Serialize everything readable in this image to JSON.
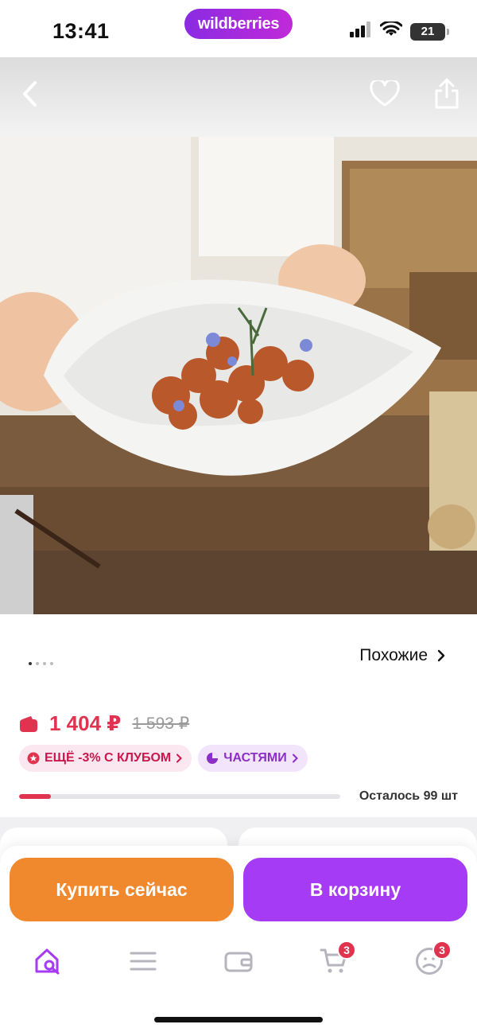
{
  "status_bar": {
    "time": "13:41",
    "app_badge": "wildberries",
    "battery": "21",
    "icons": [
      "signal-icon",
      "wifi-icon",
      "battery-icon"
    ]
  },
  "header": {
    "icons": [
      "back-icon",
      "heart-icon",
      "share-icon"
    ]
  },
  "gallery": {
    "image_description": "product-photo",
    "dots_count": 4,
    "active_dot": 0
  },
  "similar": {
    "label": "Похожие"
  },
  "price": {
    "current": "1 404 ₽",
    "old": "1 593 ₽",
    "wallet_icon": "wallet-icon"
  },
  "badges": {
    "club": "ЕЩЁ -3% С КЛУБОМ",
    "parts": "ЧАСТЯМИ"
  },
  "stock": {
    "text": "Осталось 99 шт",
    "fill_fraction": 0.1
  },
  "actions": {
    "buy_now": "Купить сейчас",
    "add_to_cart": "В корзину"
  },
  "tabbar": {
    "items": [
      {
        "name": "home",
        "icon": "home-search-icon",
        "active": true
      },
      {
        "name": "catalog",
        "icon": "menu-icon",
        "active": false
      },
      {
        "name": "wallet",
        "icon": "wallet-icon",
        "active": false
      },
      {
        "name": "cart",
        "icon": "cart-icon",
        "badge": "3",
        "active": false
      },
      {
        "name": "profile",
        "icon": "profile-icon",
        "badge": "3",
        "active": false
      }
    ]
  },
  "colors": {
    "accent_purple": "#a53bf5",
    "accent_orange": "#f0892e",
    "price_red": "#e0334f"
  }
}
